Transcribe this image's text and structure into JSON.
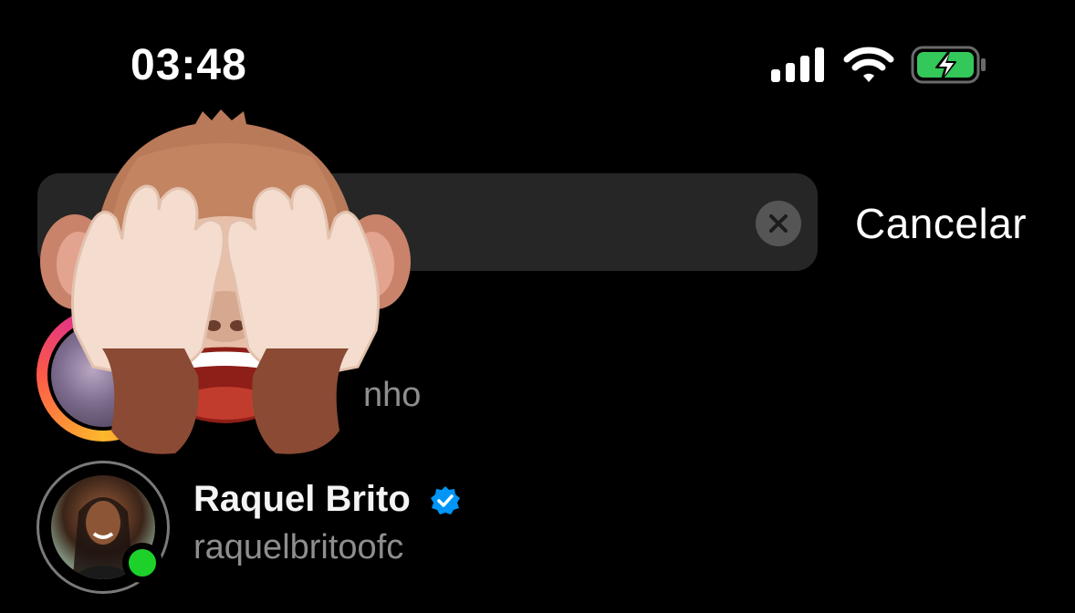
{
  "status_bar": {
    "time": "03:48",
    "signal_icon": "cellular-signal-icon",
    "wifi_icon": "wifi-icon",
    "battery_icon": "battery-charging-icon",
    "battery_color": "#34c759"
  },
  "search": {
    "query": "",
    "clear_icon": "clear-icon",
    "cancel_label": "Cancelar"
  },
  "results": [
    {
      "name": "",
      "username": "nho",
      "has_story": true
    },
    {
      "name": "Raquel Brito",
      "username": "raquelbritoofc",
      "verified": true,
      "online": true,
      "verified_color": "#0095f6",
      "online_color": "#1ed12a"
    }
  ],
  "overlay": {
    "sticker": "see-no-evil-monkey-memoji"
  }
}
